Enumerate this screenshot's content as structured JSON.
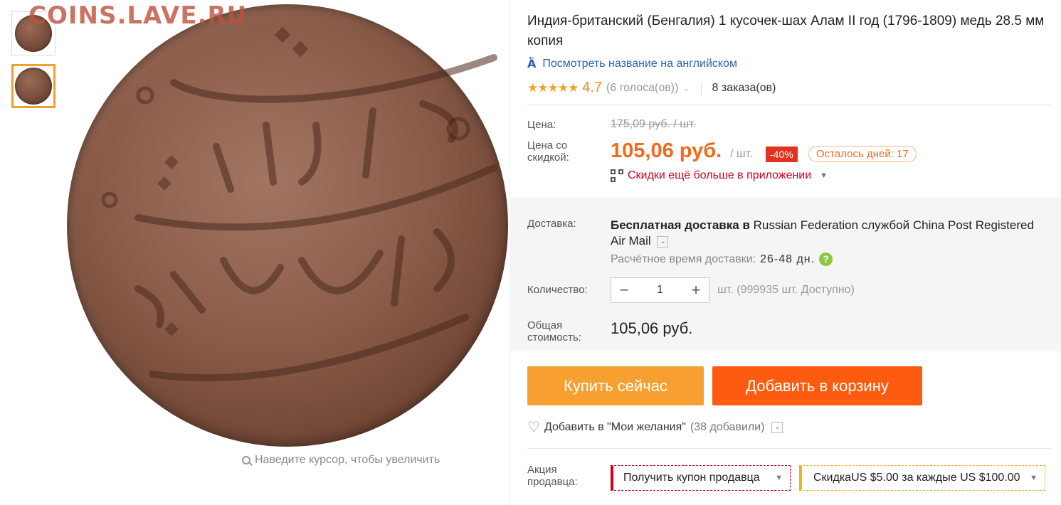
{
  "watermark": "COINS.LAVE.RU",
  "gallery": {
    "zoom_hint": "Наведите курсор, чтобы увеличить"
  },
  "product": {
    "title": "Индия-британский (Бенгалия) 1 кусочек-шах Алам II год (1796-1809) медь 28.5 мм копия",
    "translate_link": "Посмотреть название на английском",
    "rating": "4.7",
    "votes": "(6 голоса(ов))",
    "orders": "8 заказа(ов)"
  },
  "pricing": {
    "price_label": "Цена:",
    "old_price": "175,09 руб. / шт.",
    "discount_label_1": "Цена со",
    "discount_label_2": "скидкой:",
    "price": "105,06 руб.",
    "per_unit": "/ шт.",
    "discount_badge": "-40%",
    "days_left": "Осталось дней: 17",
    "app_promo": "Скидки ещё больше в приложении"
  },
  "shipping": {
    "label": "Доставка:",
    "main_bold": "Бесплатная доставка в",
    "main_rest": " Russian Federation службой China Post Registered Air Mail",
    "time_label": "Расчётное время доставки:",
    "time_value": "26-48 дн."
  },
  "quantity": {
    "label": "Количество:",
    "value": "1",
    "availability": "шт. (999935 шт. Доступно)"
  },
  "total": {
    "label_1": "Общая",
    "label_2": "стоимость:",
    "value": "105,06 руб."
  },
  "actions": {
    "buy_now": "Купить сейчас",
    "add_to_cart": "Добавить в корзину",
    "wishlist": "Добавить в \"Мои желания\"",
    "wishlist_count": "(38 добавили)"
  },
  "promo": {
    "label_1": "Акция",
    "label_2": "продавца:",
    "coupon": "Получить купон продавца",
    "store_discount_prefix": "Скидка ",
    "store_discount_amount": "US $5.00",
    "store_discount_mid": " за каждые ",
    "store_discount_threshold": "US $100.00"
  },
  "colors": {
    "accent_price": "#f26a1b",
    "buy_button": "#f7a031",
    "cart_button": "#fd5c10",
    "link": "#2a62b8",
    "promo_red": "#d0021b"
  }
}
